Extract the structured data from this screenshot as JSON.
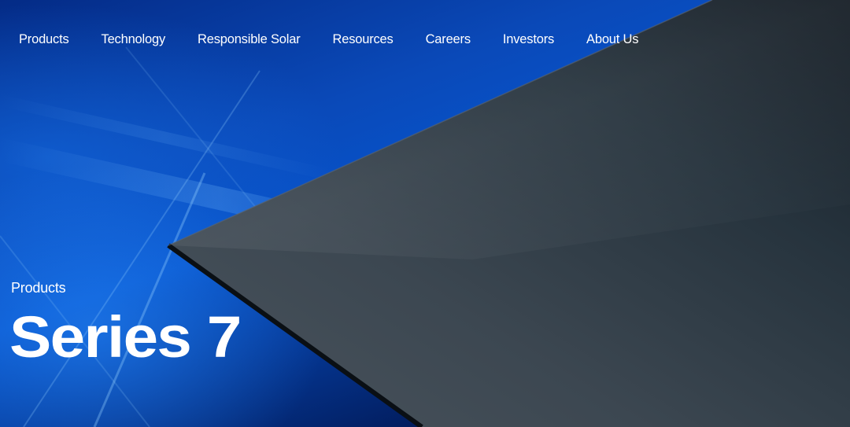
{
  "nav": {
    "items": [
      {
        "label": "Products"
      },
      {
        "label": "Technology"
      },
      {
        "label": "Responsible Solar"
      },
      {
        "label": "Resources"
      },
      {
        "label": "Careers"
      },
      {
        "label": "Investors"
      },
      {
        "label": "About Us"
      }
    ]
  },
  "hero": {
    "eyebrow": "Products",
    "title": "Series 7"
  },
  "colors": {
    "background_blue": "#0752c9",
    "background_dark": "#010b2a",
    "panel_gray": "#3a4650",
    "text": "#ffffff"
  }
}
